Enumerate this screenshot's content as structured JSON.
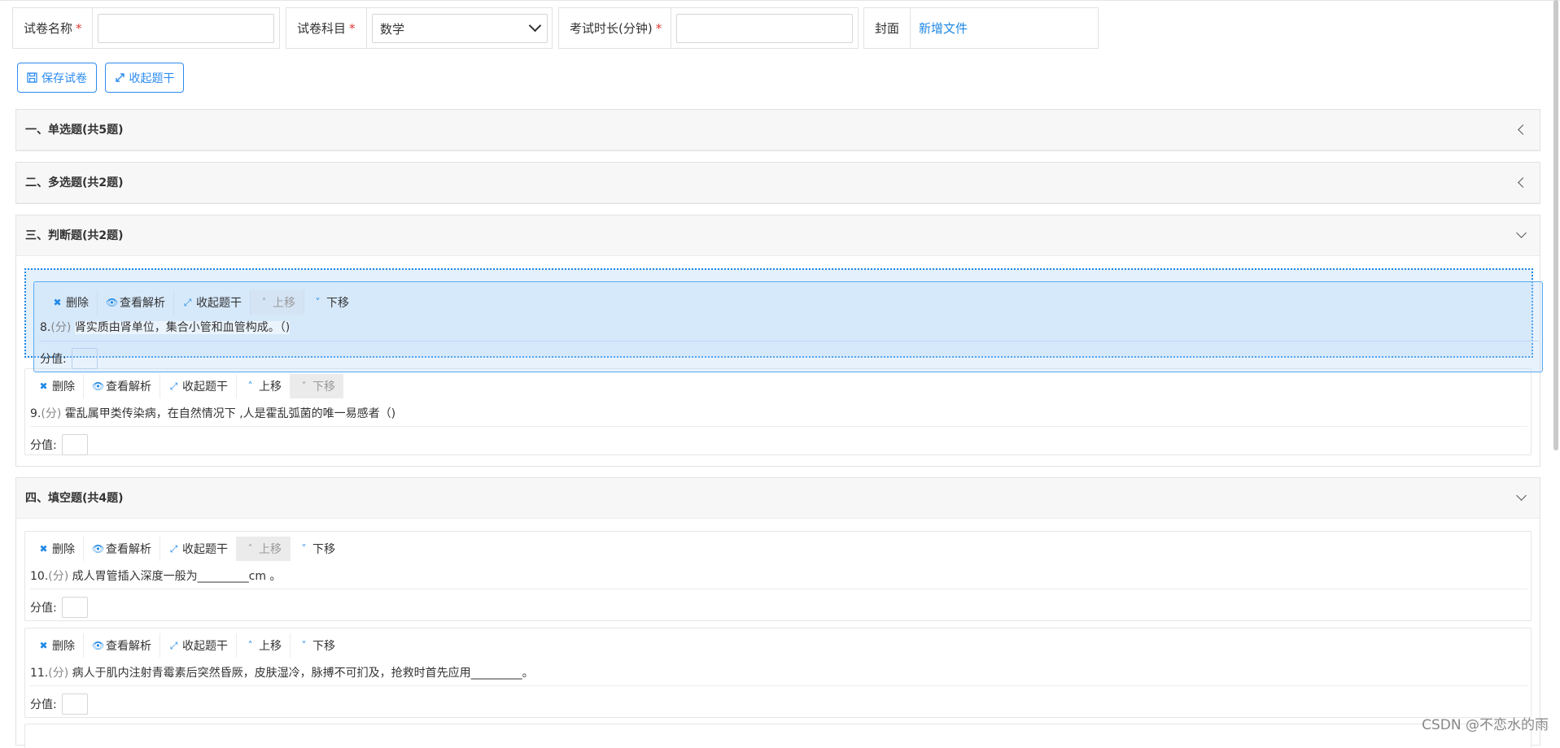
{
  "form": {
    "name": {
      "label": "试卷名称",
      "required": "*",
      "value": ""
    },
    "subject": {
      "label": "试卷科目",
      "required": "*",
      "value": "数学"
    },
    "duration": {
      "label": "考试时长(分钟)",
      "required": "*",
      "value": ""
    },
    "cover": {
      "label": "封面",
      "link": "新增文件"
    }
  },
  "toolbar": {
    "save_label": "保存试卷",
    "collapse_label": "收起题干"
  },
  "sections": [
    {
      "title": "一、单选题(共5题)",
      "expanded": false
    },
    {
      "title": "二、多选题(共2题)",
      "expanded": false
    },
    {
      "title": "三、判断题(共2题)",
      "expanded": true
    },
    {
      "title": "四、填空题(共4题)",
      "expanded": true
    }
  ],
  "question_actions": {
    "delete": "删除",
    "analysis": "查看解析",
    "collapse": "收起题干",
    "up": "上移",
    "down": "下移"
  },
  "score_label": "分值:",
  "questions": {
    "q8": {
      "number": "8.",
      "points": "(分)",
      "text": "肾实质由肾单位，集合小管和血管构成。（)"
    },
    "q9": {
      "number": "9.",
      "points": "(分)",
      "text": "霍乱属甲类传染病，在自然情况下 ,人是霍乱弧菌的唯一易感者（)"
    },
    "q10": {
      "number": "10.",
      "points": "(分)",
      "text": "成人胃管插入深度一般为_________cm 。"
    },
    "q11": {
      "number": "11.",
      "points": "(分)",
      "text": "病人于肌内注射青霉素后突然昏厥，皮肤湿冷，脉搏不可扪及，抢救时首先应用_________。"
    }
  },
  "watermark": "CSDN @不恋水的雨",
  "colors": {
    "accent": "#1e88e5",
    "required": "#e53935",
    "drag_border": "#5aa9f0"
  }
}
